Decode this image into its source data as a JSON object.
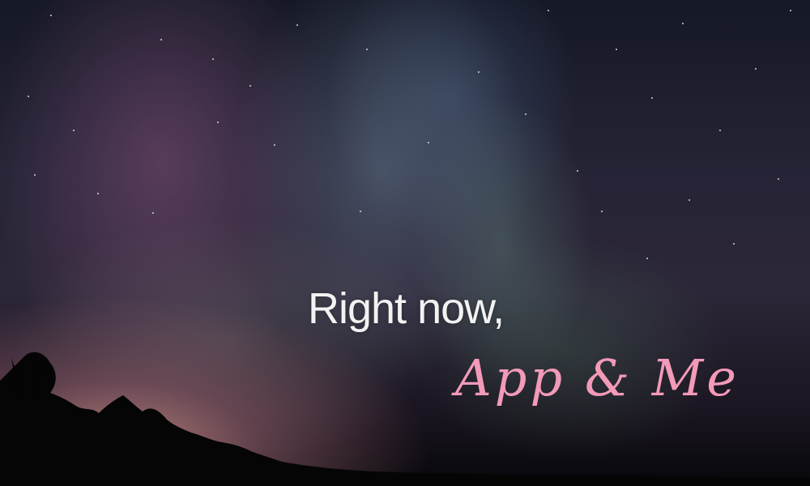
{
  "scene": {
    "headline": "Right now,",
    "brand": "App & Me",
    "brand_color": "#f39ab8"
  }
}
